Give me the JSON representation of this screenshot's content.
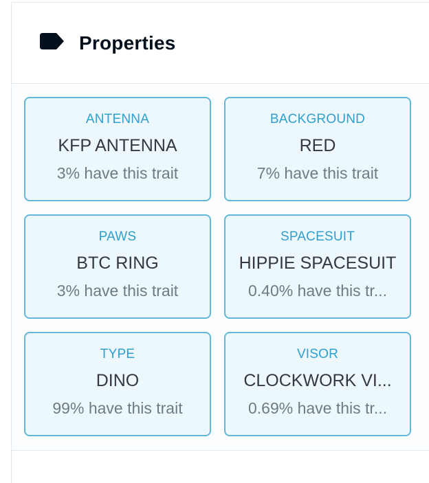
{
  "header": {
    "title": "Properties",
    "icon": "tag-icon"
  },
  "properties": [
    {
      "type": "ANTENNA",
      "value": "KFP ANTENNA",
      "rarity": "3% have this trait"
    },
    {
      "type": "BACKGROUND",
      "value": "RED",
      "rarity": "7% have this trait"
    },
    {
      "type": "PAWS",
      "value": "BTC RING",
      "rarity": "3% have this trait"
    },
    {
      "type": "SPACESUIT",
      "value": "HIPPIE SPACESUIT",
      "rarity": "0.40% have this tr..."
    },
    {
      "type": "TYPE",
      "value": "DINO",
      "rarity": "99% have this trait"
    },
    {
      "type": "VISOR",
      "value": "CLOCKWORK VI...",
      "rarity": "0.69% have this tr..."
    }
  ],
  "colors": {
    "accent": "#2e9fcf",
    "card_border": "#62b7d9",
    "title": "#04111d",
    "value_text": "#353840",
    "rarity_text": "#707a83"
  }
}
